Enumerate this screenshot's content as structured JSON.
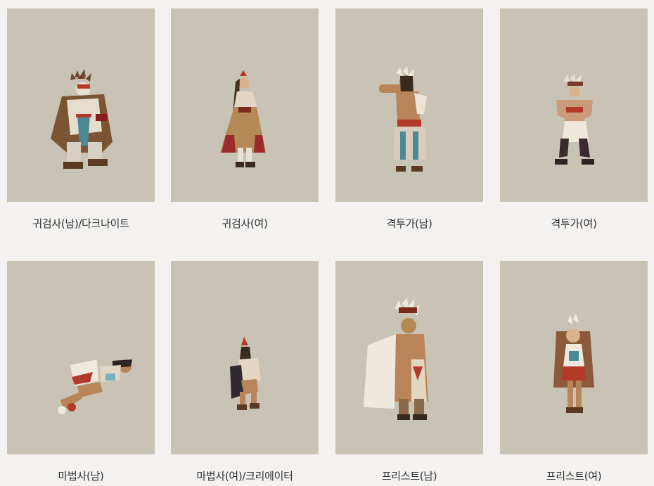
{
  "colors": {
    "page_bg": "#f3f2f0",
    "thumb_bg": "#c9c3b6",
    "label_text": "#333333"
  },
  "characters": [
    {
      "label": "귀검사(남)/다크나이트",
      "icon": "character-sprite-slayer-male"
    },
    {
      "label": "귀검사(여)",
      "icon": "character-sprite-slayer-female"
    },
    {
      "label": "격투가(남)",
      "icon": "character-sprite-fighter-male"
    },
    {
      "label": "격투가(여)",
      "icon": "character-sprite-fighter-female"
    },
    {
      "label": "마법사(남)",
      "icon": "character-sprite-mage-male"
    },
    {
      "label": "마법사(여)/크리에이터",
      "icon": "character-sprite-mage-female"
    },
    {
      "label": "프리스트(남)",
      "icon": "character-sprite-priest-male"
    },
    {
      "label": "프리스트(여)",
      "icon": "character-sprite-priest-female"
    }
  ]
}
